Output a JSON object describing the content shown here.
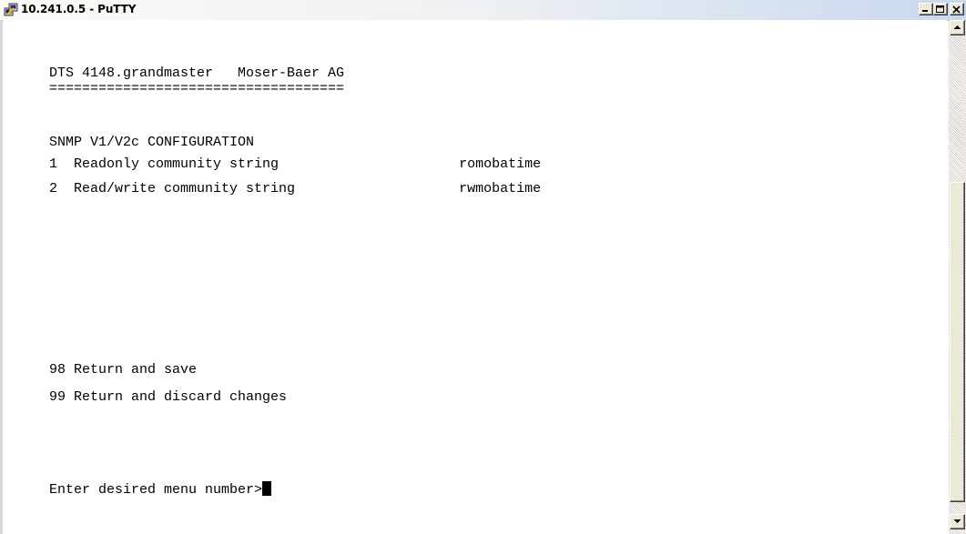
{
  "window": {
    "title": "10.241.0.5 - PuTTY",
    "buttons": [
      "minimize",
      "maximize",
      "close"
    ]
  },
  "terminal": {
    "lines": [
      "DTS 4148.grandmaster   Moser-Baer AG",
      "====================================",
      "",
      "SNMP V1/V2c CONFIGURATION",
      "1  Readonly community string                      romobatime",
      "2  Read/write community string                    rwmobatime",
      "98 Return and save",
      "99 Return and discard changes",
      "Enter desired menu number>"
    ]
  },
  "icons": {
    "app": "putty-icon",
    "minimize": "minimize-icon",
    "maximize": "maximize-icon",
    "close": "close-icon",
    "scroll_up": "scroll-up-arrow-icon",
    "scroll_down": "scroll-down-arrow-icon"
  },
  "colors": {
    "terminal_bg": "#ffffff",
    "terminal_fg": "#000000"
  }
}
